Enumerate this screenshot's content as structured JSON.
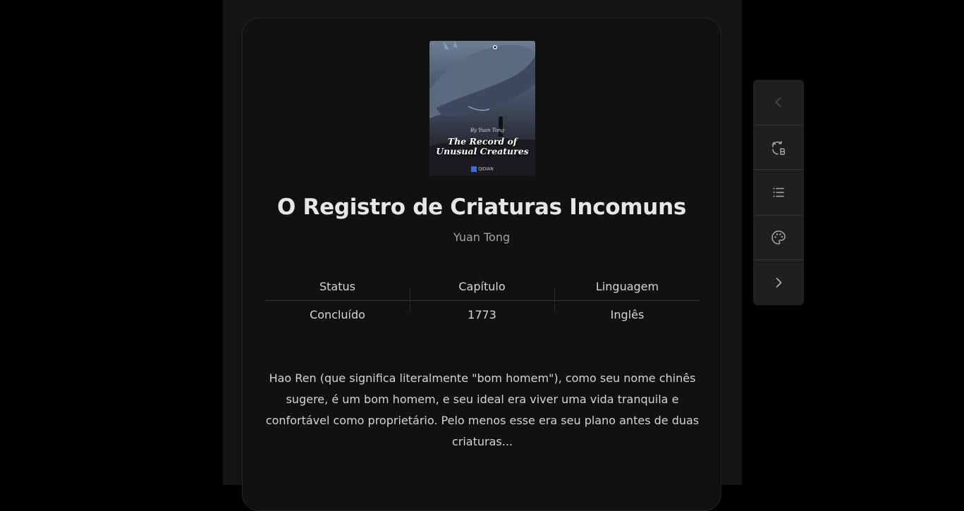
{
  "book": {
    "cover": {
      "byline": "By Yuan Tong",
      "title": "The Record of Unusual Creatures",
      "publisher": "QIDIAN"
    },
    "title": "O Registro de Criaturas Incomuns",
    "author": "Yuan Tong",
    "info": {
      "headers": [
        "Status",
        "Capítulo",
        "Linguagem"
      ],
      "values": [
        "Concluído",
        "1773",
        "Inglês"
      ]
    },
    "synopsis": "Hao Ren (que significa literalmente \"bom homem\"), como seu nome chinês sugere, é um bom homem, e seu ideal era viver uma vida tranquila e confortável como proprietário. Pelo menos esse era seu plano antes de duas criaturas..."
  },
  "toolbar": {
    "buttons": [
      {
        "icon": "chevron-left-icon",
        "enabled": false
      },
      {
        "icon": "translate-icon",
        "enabled": true
      },
      {
        "icon": "list-icon",
        "enabled": true
      },
      {
        "icon": "palette-icon",
        "enabled": true
      },
      {
        "icon": "chevron-right-icon",
        "enabled": true
      }
    ]
  },
  "colors": {
    "page_background": "#000000",
    "column_background": "#141414",
    "card_background": "#111111",
    "toolbar_background": "#1f1f1f",
    "title_text": "#e6e6e6",
    "muted_text": "#a3a3a3"
  }
}
